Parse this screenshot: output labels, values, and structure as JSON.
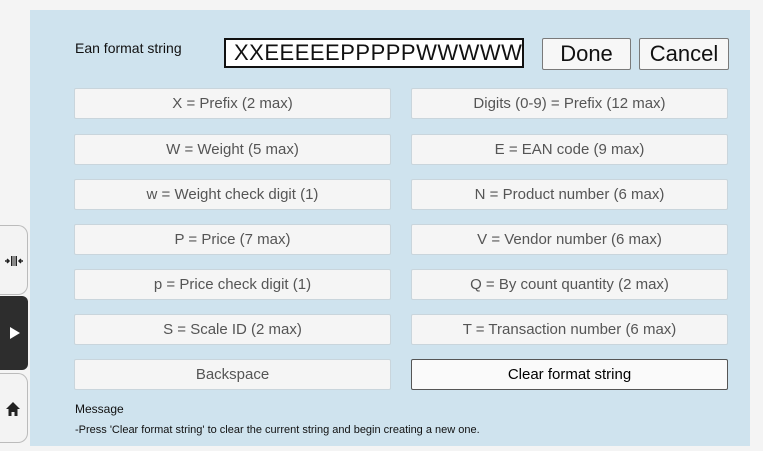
{
  "header": {
    "title": "Ean format string",
    "format_value": "XXEEEEEPPPPPWWWWWW",
    "done_label": "Done",
    "cancel_label": "Cancel"
  },
  "buttons_left": [
    "X = Prefix (2 max)",
    "W = Weight (5 max)",
    "w = Weight check digit (1)",
    "P = Price (7 max)",
    "p = Price check digit (1)",
    "S = Scale ID (2 max)",
    "Backspace"
  ],
  "buttons_right": [
    "Digits (0-9) = Prefix (12 max)",
    "E = EAN code (9 max)",
    "N = Product number (6 max)",
    "V = Vendor number (6 max)",
    "Q = By count quantity (2 max)",
    "T = Transaction number (6 max)",
    "Clear format string"
  ],
  "message": {
    "label": "Message",
    "text": "-Press 'Clear format string' to clear the current string and begin creating a new one."
  },
  "dock": {
    "icons": [
      "barcode-scan-icon",
      "play-icon",
      "home-icon"
    ]
  }
}
